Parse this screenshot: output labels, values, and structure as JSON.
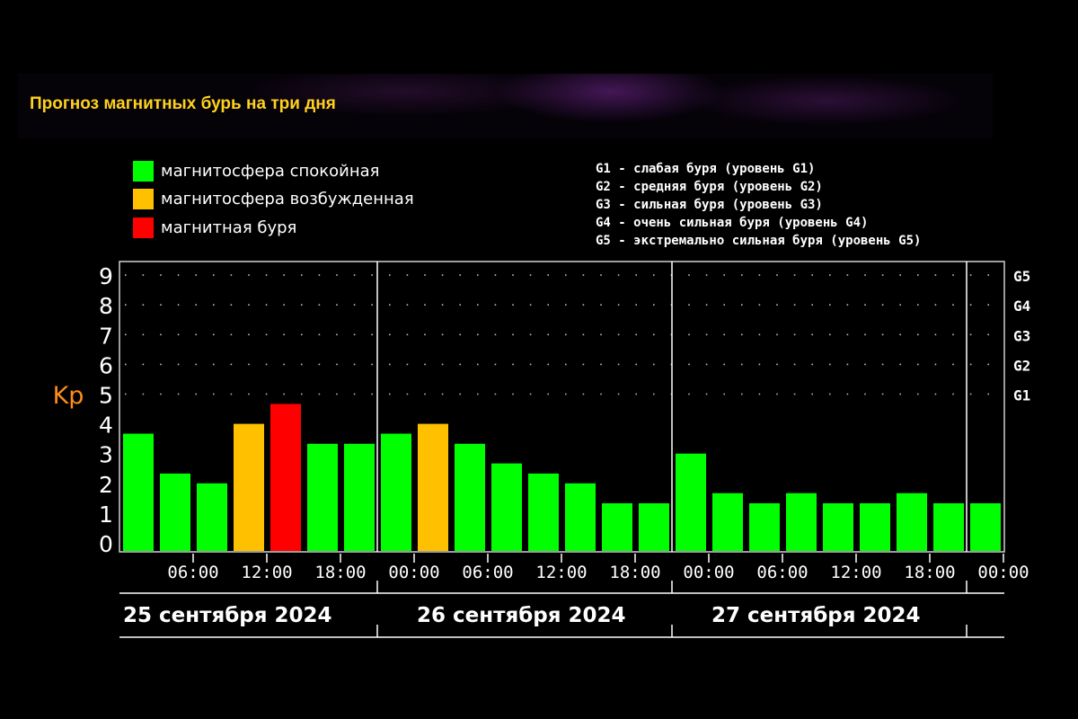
{
  "title": "Прогноз магнитных бурь на три дня",
  "legend": [
    {
      "color": "#00ff00",
      "label": "магнитосфера спокойная"
    },
    {
      "color": "#ffc000",
      "label": "магнитосфера возбужденная"
    },
    {
      "color": "#ff0000",
      "label": "магнитная буря"
    }
  ],
  "g_legend": [
    "G1 - слабая буря (уровень G1)",
    "G2 - средняя буря (уровень G2)",
    "G3 - сильная буря (уровень G3)",
    "G4 - очень сильная буря (уровень G4)",
    "G5 - экстремально сильная буря (уровень G5)"
  ],
  "chart_data": {
    "type": "bar",
    "ylabel": "Kp",
    "ylim": [
      0,
      9
    ],
    "y_ticks": [
      "0",
      "1",
      "2",
      "3",
      "4",
      "5",
      "6",
      "7",
      "8",
      "9"
    ],
    "right_ticks": [
      {
        "kp": 5,
        "label": "G1"
      },
      {
        "kp": 6,
        "label": "G2"
      },
      {
        "kp": 7,
        "label": "G3"
      },
      {
        "kp": 8,
        "label": "G4"
      },
      {
        "kp": 9,
        "label": "G5"
      }
    ],
    "x_ticks": [
      "06:00",
      "12:00",
      "18:00",
      "00:00",
      "06:00",
      "12:00",
      "18:00",
      "00:00",
      "06:00",
      "12:00",
      "18:00",
      "00:00"
    ],
    "days": [
      "25 сентября 2024",
      "26 сентября 2024",
      "27 сентября 2024"
    ],
    "grid": "dotted",
    "values": [
      3.67,
      2.33,
      2.0,
      4.0,
      4.67,
      3.33,
      3.33,
      3.67,
      4.0,
      3.33,
      2.67,
      2.33,
      2.0,
      1.33,
      1.33,
      3.0,
      1.67,
      1.33,
      1.67,
      1.33,
      1.33,
      1.67,
      1.33,
      1.33
    ],
    "colors": [
      "#00ff00",
      "#00ff00",
      "#00ff00",
      "#ffc000",
      "#ff0000",
      "#00ff00",
      "#00ff00",
      "#00ff00",
      "#ffc000",
      "#00ff00",
      "#00ff00",
      "#00ff00",
      "#00ff00",
      "#00ff00",
      "#00ff00",
      "#00ff00",
      "#00ff00",
      "#00ff00",
      "#00ff00",
      "#00ff00",
      "#00ff00",
      "#00ff00",
      "#00ff00",
      "#00ff00"
    ]
  }
}
